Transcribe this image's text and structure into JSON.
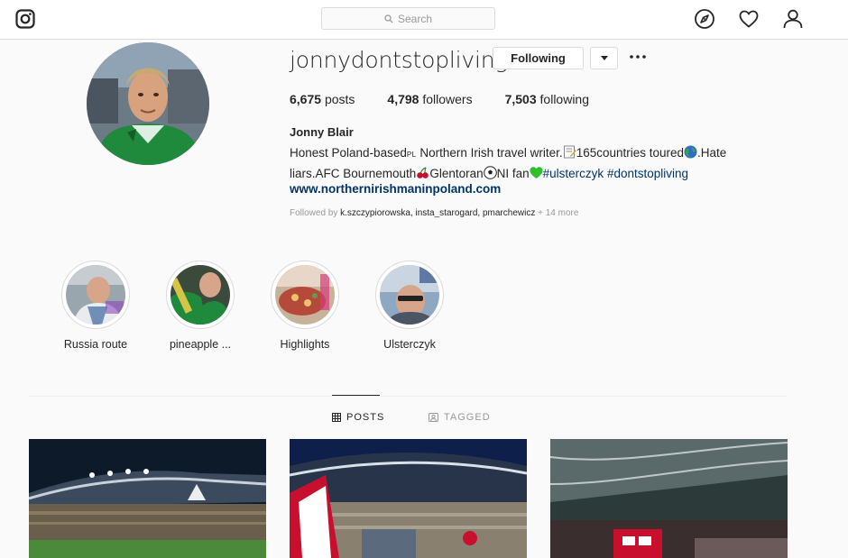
{
  "header": {
    "search_placeholder": "Search"
  },
  "profile": {
    "username": "jonnydontstopliving",
    "following_button": "Following",
    "more_label": "•••",
    "stats": {
      "posts_count": "6,675",
      "posts_label": "posts",
      "followers_count": "4,798",
      "followers_label": "followers",
      "following_count": "7,503",
      "following_label": "following"
    },
    "full_name": "Jonny Blair",
    "bio": {
      "line1_a": "Honest Poland-based",
      "flag_pl": "PL",
      "line1_b": " Northern Irish travel writer.",
      "line1_c": "165countries toured",
      "line1_d": ".Hate",
      "line2_a": "liars.AFC Bournemouth",
      "line2_b": "Glentoran",
      "line2_c": "NI fan",
      "hashtag1": "#ulsterczyk",
      "hashtag2": "#dontstopliving"
    },
    "website": "www.northernirishmaninpoland.com",
    "followed_by_prefix": "Followed by",
    "followed_by_names": "k.szczypiorowska, insta_starogard, pmarchewicz",
    "followed_by_more": "+ 14 more"
  },
  "highlights": [
    {
      "label": "Russia route"
    },
    {
      "label": "pineapple ..."
    },
    {
      "label": "Highlights"
    },
    {
      "label": "Ulsterczyk"
    }
  ],
  "tabs": {
    "posts": "POSTS",
    "tagged": "TAGGED"
  },
  "colors": {
    "link": "#003569",
    "border": "#dbdbdb",
    "background": "#fafafa"
  }
}
